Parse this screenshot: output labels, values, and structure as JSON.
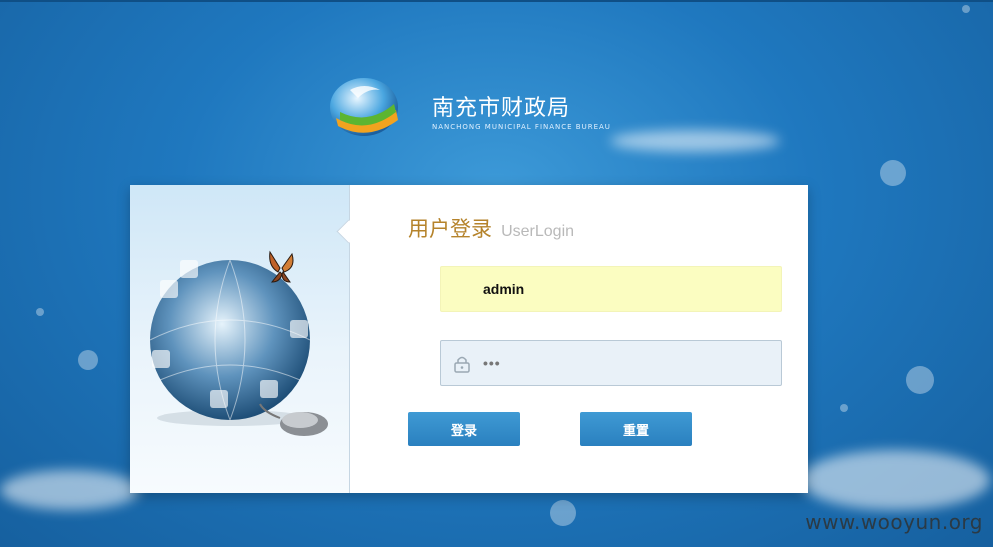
{
  "header": {
    "org_name": "南充市财政局",
    "org_name_en": "NANCHONG MUNICIPAL FINANCE BUREAU",
    "logo_icon": "globe-logo-icon"
  },
  "login": {
    "title": "用户登录",
    "title_en": "UserLogin",
    "username_value": "admin",
    "password_mask": "•••",
    "login_button": "登录",
    "reset_button": "重置",
    "illustration_icon": "puzzle-globe-butterfly-mouse-illustration"
  },
  "watermark": "www.wooyun.org",
  "colors": {
    "background": "#1f78bf",
    "title": "#b5832b",
    "button": "#3a93d0",
    "username_bg": "#fbfdc1",
    "password_bg": "#e9f1f8"
  }
}
